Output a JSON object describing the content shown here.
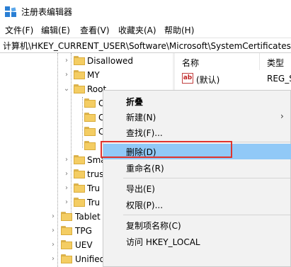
{
  "window": {
    "title": "注册表编辑器"
  },
  "menubar": [
    {
      "label": "文件(F)"
    },
    {
      "label": "编辑(E)"
    },
    {
      "label": "查看(V)"
    },
    {
      "label": "收藏夹(A)"
    },
    {
      "label": "帮助(H)"
    }
  ],
  "address": {
    "path": "计算机\\HKEY_CURRENT_USER\\Software\\Microsoft\\SystemCertificates\\R"
  },
  "tree": {
    "items": [
      {
        "label": "Disallowed"
      },
      {
        "label": "MY"
      },
      {
        "label": "Root"
      },
      {
        "label": "C"
      },
      {
        "label": "C"
      },
      {
        "label": "C"
      },
      {
        "label": ""
      },
      {
        "label": "Sma"
      },
      {
        "label": "trus"
      },
      {
        "label": "Tru"
      },
      {
        "label": "Tru"
      },
      {
        "label": "Tablet"
      },
      {
        "label": "TPG"
      },
      {
        "label": "UEV"
      },
      {
        "label": "Unified Store"
      }
    ]
  },
  "right_pane": {
    "columns": [
      {
        "label": "名称"
      },
      {
        "label": "类型"
      }
    ],
    "rows": [
      {
        "icon": "ab",
        "name": "(默认)",
        "type": "REG_S"
      }
    ]
  },
  "context_menu": {
    "items": [
      {
        "label": "折叠"
      },
      {
        "label": "新建(N)",
        "submenu_arrow": "›"
      },
      {
        "label": "查找(F)..."
      },
      {
        "label": "删除(D)"
      },
      {
        "label": "重命名(R)"
      },
      {
        "label": "导出(E)"
      },
      {
        "label": "权限(P)..."
      },
      {
        "label": "复制项名称(C)"
      },
      {
        "label": "访问 HKEY_LOCAL"
      }
    ]
  },
  "colors": {
    "highlight": "#91c9f7",
    "annotation_box": "#e0342d",
    "folder": "#f4cd63"
  }
}
